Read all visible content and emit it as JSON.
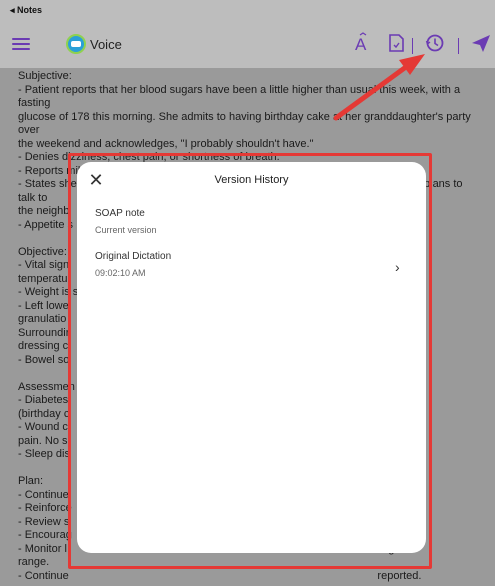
{
  "statusbar": {
    "back_label": "◂ Notes"
  },
  "toolbar": {
    "app_name": "Voice",
    "icons": [
      "menu-icon",
      "voice-logo-icon",
      "text-size-icon",
      "document-icon",
      "history-icon",
      "send-icon"
    ]
  },
  "note": {
    "lines": [
      "Subjective:",
      "- Patient reports that her blood sugars have been a little higher than usual this week, with a fasting",
      "glucose of 178 this morning. She admits to having birthday cake at her granddaughter's party over",
      "the weekend and acknowledges, \"I probably shouldn't have.\"",
      "- Denies dizziness, chest pain, or shortness of breath.",
      "- Reports mild fatigue in the afternoons.",
      "- States she has tried to make small changes and is scheduled to talk to a dietitian; plans to talk to",
      "the neighb",
      "- Appetite s",
      "",
      "Objective:",
      "- Vital sign",
      "temperatu",
      "- Weight is s",
      "- Left lowe                                                                                                   pink",
      "granulatio                                                                                                   essing.",
      "Surroundir                                                                                                   0 during",
      "dressing c",
      "- Bowel so",
      "",
      "Assessmen",
      "- Diabetes                                                                                                   retion",
      "(birthday c",
      "- Wound c                                                                                                     nd mild",
      "pain. No si",
      "- Sleep dis",
      "",
      "Plan:",
      "- Continue",
      "- Reinforce",
      "- Review s",
      "- Encourag",
      "- Monitor l                                                                                                     target",
      "range.",
      "- Continue                                                                                                     reported."
    ]
  },
  "modal": {
    "title": "Version History",
    "versions": [
      {
        "name": "SOAP note",
        "detail": "Current version"
      },
      {
        "name": "Original Dictation",
        "detail": "09:02:10 AM"
      }
    ]
  }
}
